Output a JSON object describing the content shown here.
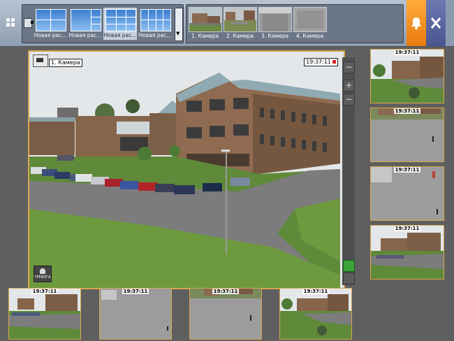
{
  "toolbar": {
    "layouts": [
      {
        "label": "Новая рас...",
        "selected": false,
        "grid": "2x2"
      },
      {
        "label": "Новая рас...",
        "selected": false,
        "grid": "1+3"
      },
      {
        "label": "Новая рас...",
        "selected": true,
        "grid": "3x3"
      },
      {
        "label": "Новая рас...",
        "selected": false,
        "grid": "2x4"
      }
    ],
    "layout_scroll_glyph": "▼",
    "cameras": [
      {
        "label": "1. Камера"
      },
      {
        "label": "2. Камера"
      },
      {
        "label": "3. Камера"
      },
      {
        "label": "4. Камера"
      }
    ],
    "alarm_icon": "bell-icon",
    "tools_icon": "tools-icon",
    "colors": {
      "accent_orange": "#f39422",
      "accent_purple": "#5a65a0",
      "frame_gold": "#d8a74e"
    }
  },
  "main_view": {
    "camera_label": "1. Камера",
    "time": "19:37:11",
    "alarm_caption": "ТРЕВОГА"
  },
  "controls": {
    "minus": "−",
    "plus": "+",
    "minus2": "−"
  },
  "side_thumbs": [
    {
      "time": "19:37:11"
    },
    {
      "time": "19:37:11"
    },
    {
      "time": "19:37:11"
    },
    {
      "time": "19:37:11"
    }
  ],
  "bottom_thumbs": [
    {
      "time": "19:37:11"
    },
    {
      "time": "19:37:11"
    },
    {
      "time": "19:37:11"
    },
    {
      "time": "19:37:11"
    }
  ]
}
